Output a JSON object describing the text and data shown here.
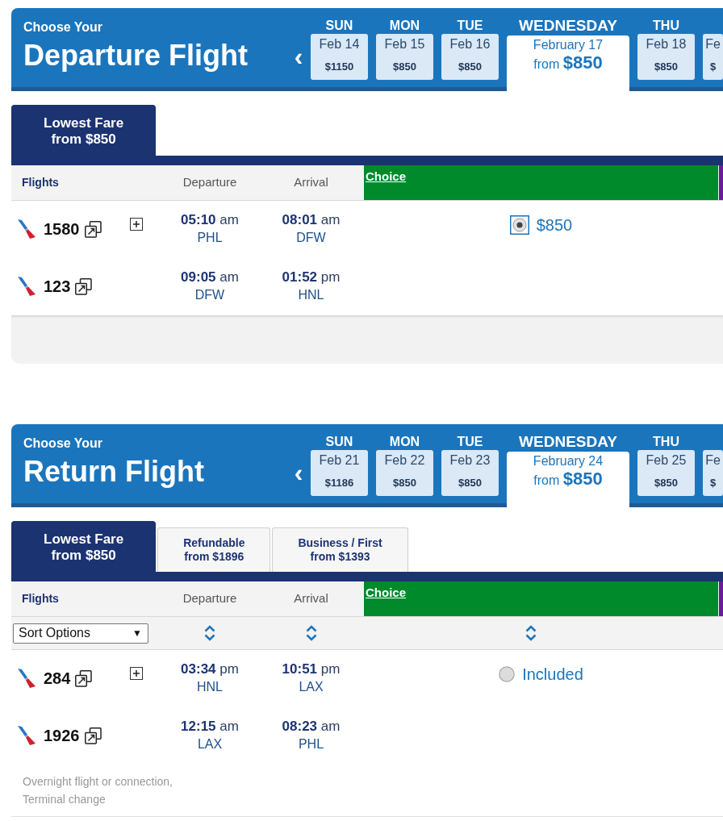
{
  "sections": [
    {
      "eyebrow": "Choose Your",
      "title": "Departure Flight",
      "prev": "‹",
      "days": [
        {
          "day": "SUN",
          "date": "Feb 14",
          "price": "$1150",
          "selected": false
        },
        {
          "day": "MON",
          "date": "Feb 15",
          "price": "$850",
          "selected": false
        },
        {
          "day": "TUE",
          "date": "Feb 16",
          "price": "$850",
          "selected": false
        },
        {
          "day": "WEDNESDAY",
          "date": "February 17",
          "price": "from **$850**",
          "selected": true
        },
        {
          "day": "THU",
          "date": "Feb 18",
          "price": "$850",
          "selected": false
        },
        {
          "date": "Fe",
          "price": "$",
          "selected": false
        }
      ],
      "fare_tabs": [
        {
          "title": "Lowest Fare",
          "subtitle": "from $850",
          "selected": true
        }
      ],
      "columns": [
        "Flights",
        "Departure",
        "Arrival"
      ],
      "fare_columns": [
        {
          "label": "Choice",
          "color": "#008a2b"
        },
        {
          "color": "#6a1b9a"
        }
      ],
      "itineraries": [
        {
          "segments": [
            {
              "number": "1580",
              "expandable": true,
              "departure": "**05:10** am",
              "from": "PHL",
              "arrival": "**08:01** am",
              "to": "DFW"
            },
            {
              "number": "123",
              "expandable": false,
              "departure": "**09:05** am",
              "from": "DFW",
              "arrival": "**01:52** pm",
              "to": "HNL"
            }
          ],
          "fare": {
            "label": "$850",
            "selected": true
          }
        }
      ],
      "footer_panel": true
    },
    {
      "eyebrow": "Choose Your",
      "title": "Return Flight",
      "prev": "‹",
      "days": [
        {
          "day": "SUN",
          "date": "Feb 21",
          "price": "$1186",
          "selected": false
        },
        {
          "day": "MON",
          "date": "Feb 22",
          "price": "$850",
          "selected": false
        },
        {
          "day": "TUE",
          "date": "Feb 23",
          "price": "$850",
          "selected": false
        },
        {
          "day": "WEDNESDAY",
          "date": "February 24",
          "price": "from **$850**",
          "selected": true
        },
        {
          "day": "THU",
          "date": "Feb 25",
          "price": "$850",
          "selected": false
        },
        {
          "date": "Fe",
          "price": "$",
          "selected": false
        }
      ],
      "fare_tabs": [
        {
          "title": "Lowest Fare",
          "subtitle": "from $850",
          "selected": true
        },
        {
          "title": "Refundable",
          "subtitle": "from $1896",
          "selected": false
        },
        {
          "title": "Business / First",
          "subtitle": "from $1393",
          "selected": false
        }
      ],
      "columns": [
        "Flights",
        "Departure",
        "Arrival"
      ],
      "fare_columns": [
        {
          "label": "Choice",
          "color": "#008a2b"
        },
        {
          "color": "#6a1b9a"
        }
      ],
      "sort": {
        "label": "Sort Options",
        "caret": "▼"
      },
      "itineraries": [
        {
          "segments": [
            {
              "number": "284",
              "expandable": true,
              "departure": "**03:34** pm",
              "from": "HNL",
              "arrival": "**10:51** pm",
              "to": "LAX"
            },
            {
              "number": "1926",
              "expandable": false,
              "departure": "**12:15** am",
              "from": "LAX",
              "arrival": "**08:23** am",
              "to": "PHL"
            }
          ],
          "fare": {
            "label": "Included",
            "selected": false
          },
          "notes": [
            "Overnight flight or connection,",
            "Terminal change"
          ]
        }
      ]
    }
  ]
}
